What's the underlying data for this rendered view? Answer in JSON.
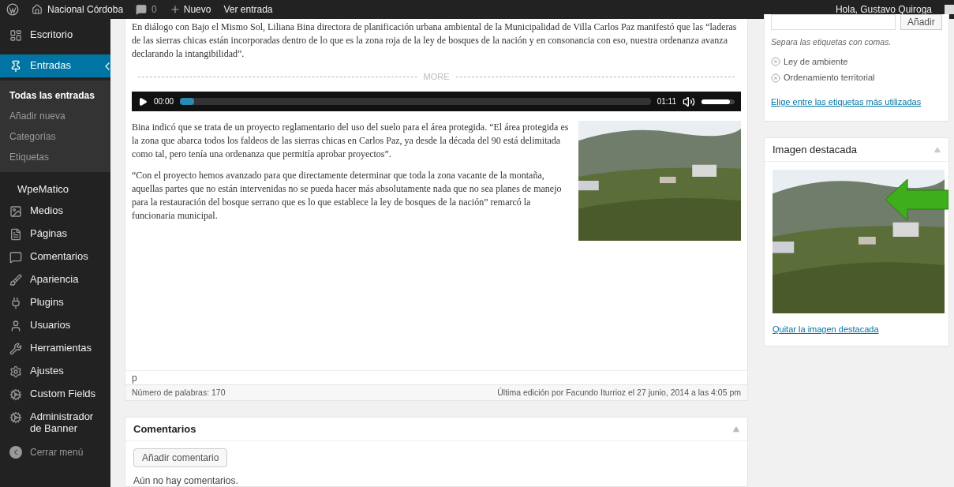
{
  "admin_bar": {
    "site_name": "Nacional Córdoba",
    "comments_count": "0",
    "new_label": "Nuevo",
    "view_label": "Ver entrada",
    "greeting": "Hola, Gustavo Quiroga"
  },
  "sidebar": {
    "items": [
      {
        "label": "Escritorio",
        "selected": false
      },
      {
        "label": "Entradas",
        "selected": true,
        "children": [
          {
            "label": "Todas las entradas",
            "selected": true
          },
          {
            "label": "Añadir nueva",
            "selected": false
          },
          {
            "label": "Categorías",
            "selected": false
          },
          {
            "label": "Etiquetas",
            "selected": false
          }
        ]
      },
      {
        "label": "WpeMatico",
        "selected": false
      },
      {
        "label": "Medios",
        "selected": false
      },
      {
        "label": "Páginas",
        "selected": false
      },
      {
        "label": "Comentarios",
        "selected": false
      },
      {
        "label": "Apariencia",
        "selected": false
      },
      {
        "label": "Plugins",
        "selected": false
      },
      {
        "label": "Usuarios",
        "selected": false
      },
      {
        "label": "Herramientas",
        "selected": false
      },
      {
        "label": "Ajustes",
        "selected": false
      },
      {
        "label": "Custom Fields",
        "selected": false
      },
      {
        "label": "Administrador de Banner",
        "selected": false
      }
    ],
    "collapse_label": "Cerrar menú"
  },
  "editor": {
    "paragraphs_top": [
      "En diálogo con Bajo el Mismo Sol, Liliana Bina directora de planificación urbana ambiental de la Municipalidad de Villa Carlos Paz manifestó que las “laderas de las sierras chicas están incorporadas dentro de lo que es la zona roja de la ley de bosques de la nación y en consonancia con eso, nuestra ordenanza avanza declarando la intangibilidad”."
    ],
    "more_label": "MORE",
    "audio": {
      "current_time": "00:00",
      "progress": {
        "level": 0.03
      },
      "duration": "01:11",
      "volume": {
        "level": 0.85
      }
    },
    "paragraphs": [
      "Bina indicó que se trata de un proyecto reglamentario del uso del suelo para el área protegida. “El área protegida es la zona que abarca todos los faldeos de las sierras chicas en Carlos Paz, ya desde la década del 90 está delimitada como tal, pero tenía una ordenanza que permitía aprobar proyectos”.",
      "“Con el proyecto hemos avanzado para que directamente determinar que toda la zona vacante de la montaña, aquellas partes que no están intervenidas no se pueda hacer más absolutamente nada que no sea planes de manejo para la restauración del bosque serrano que es lo que establece la ley de bosques de la nación” remarcó la funcionaria municipal."
    ],
    "path": "p",
    "word_count": "Número de palabras: 170",
    "last_edit": "Última edición por Facundo Iturrioz el 27 junio, 2014 a las 4:05 pm"
  },
  "comments_box": {
    "title": "Comentarios",
    "add_button": "Añadir comentario",
    "empty_text": "Aún no hay comentarios."
  },
  "tags_box": {
    "add_button": "Añadir",
    "hint": "Separa las etiquetas con comas.",
    "tags": [
      "Ley de ambiente",
      "Ordenamiento territorial"
    ],
    "link": "Elige entre las etiquetas más utilizadas"
  },
  "featured_image_box": {
    "title": "Imagen destacada",
    "remove_link": "Quitar la imagen destacada"
  }
}
